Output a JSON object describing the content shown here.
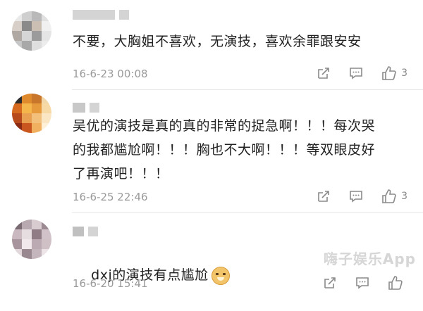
{
  "comments": [
    {
      "text": "不要，大胸姐不喜欢，无演技，喜欢余罪跟安安",
      "time": "16-6-23 00:08",
      "like_count": "3",
      "avatar_colors": [
        "#e9e9e9",
        "#cfcfcf",
        "#b9b9b9",
        "#e0e0e0",
        "#d8d0c8",
        "#8a8a8a",
        "#cbbfb3",
        "#f0f0f0",
        "#b0a9a3",
        "#d6d6d6",
        "#9b9b9b",
        "#e5e5e5",
        "#c6c6c6",
        "#a8a8a8",
        "#dedede",
        "#ececec"
      ]
    },
    {
      "text": "吴优的演技是真的真的非常的捉急啊！！！每次哭的我都尴尬啊！！！胸也不大啊！！！等双眼皮好了再演吧！！！",
      "time": "16-6-25 22:46",
      "like_count": "3",
      "avatar_colors": [
        "#2c2c2c",
        "#e08a2e",
        "#c7762a",
        "#f2d7a8",
        "#d66a1e",
        "#f4b54a",
        "#e79a3c",
        "#f7d9a6",
        "#b74a1a",
        "#e8a050",
        "#f2c07a",
        "#fbe6c4",
        "#8a2a12",
        "#c8561e",
        "#f0b060",
        "#fff0d8"
      ]
    },
    {
      "text": "dxj的演技有点尴尬",
      "time": "16-6-20 15:41",
      "like_count": "",
      "avatar_colors": [
        "#7a6a72",
        "#b8a8b0",
        "#d8ccd0",
        "#9c8a92",
        "#c9b8c0",
        "#e6dde0",
        "#8f7c84",
        "#d0c2c8",
        "#a8949c",
        "#f0e8ea",
        "#bcaab2",
        "#cfc0c6",
        "#e2d8dc",
        "#9a8890",
        "#c4b4bb",
        "#ece4e6"
      ]
    }
  ],
  "watermark": "嗨子娱乐App"
}
